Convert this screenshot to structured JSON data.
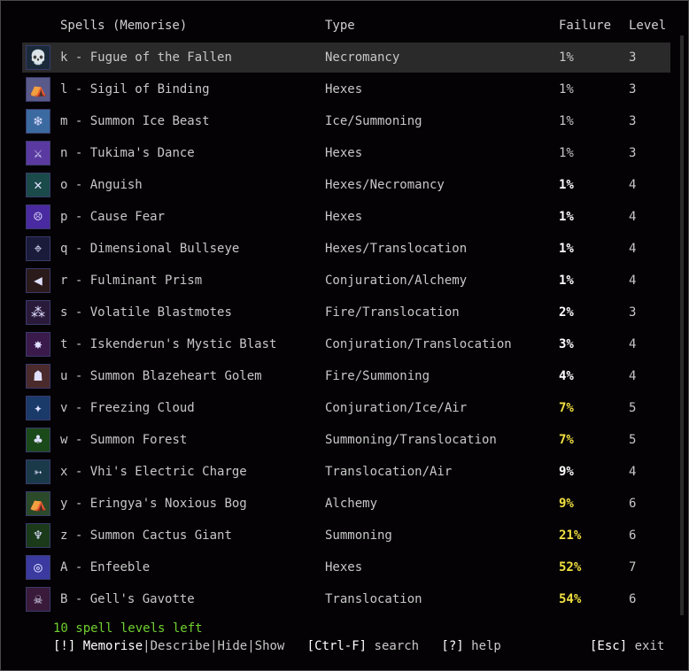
{
  "header": {
    "spells": "Spells (Memorise)",
    "type": "Type",
    "failure": "Failure",
    "level": "Level"
  },
  "spells": [
    {
      "key": "k",
      "name": "Fugue of the Fallen",
      "type": "Necromancy",
      "failure": "1%",
      "level": "3",
      "fail_style": "gray",
      "icon": "skull-icon",
      "glyph": "💀",
      "icon_bg": "#1a2a3a",
      "selected": true
    },
    {
      "key": "l",
      "name": "Sigil of Binding",
      "type": "Hexes",
      "failure": "1%",
      "level": "3",
      "fail_style": "gray",
      "icon": "sigil-icon",
      "glyph": "⛺",
      "icon_bg": "#5a5a8a",
      "selected": false
    },
    {
      "key": "m",
      "name": "Summon Ice Beast",
      "type": "Ice/Summoning",
      "failure": "1%",
      "level": "3",
      "fail_style": "gray",
      "icon": "ice-beast-icon",
      "glyph": "❄",
      "icon_bg": "#3a6aa0",
      "selected": false
    },
    {
      "key": "n",
      "name": "Tukima's Dance",
      "type": "Hexes",
      "failure": "1%",
      "level": "3",
      "fail_style": "gray",
      "icon": "dance-icon",
      "glyph": "⚔",
      "icon_bg": "#5a3aa0",
      "selected": false
    },
    {
      "key": "o",
      "name": "Anguish",
      "type": "Hexes/Necromancy",
      "failure": "1%",
      "level": "4",
      "fail_style": "white",
      "icon": "anguish-icon",
      "glyph": "✕",
      "icon_bg": "#1a4a4a",
      "selected": false
    },
    {
      "key": "p",
      "name": "Cause Fear",
      "type": "Hexes",
      "failure": "1%",
      "level": "4",
      "fail_style": "white",
      "icon": "fear-icon",
      "glyph": "☹",
      "icon_bg": "#4a2aa0",
      "selected": false
    },
    {
      "key": "q",
      "name": "Dimensional Bullseye",
      "type": "Hexes/Translocation",
      "failure": "1%",
      "level": "4",
      "fail_style": "white",
      "icon": "bullseye-icon",
      "glyph": "⌖",
      "icon_bg": "#1a1a3a",
      "selected": false
    },
    {
      "key": "r",
      "name": "Fulminant Prism",
      "type": "Conjuration/Alchemy",
      "failure": "1%",
      "level": "4",
      "fail_style": "white",
      "icon": "prism-icon",
      "glyph": "◀",
      "icon_bg": "#2a1a1a",
      "selected": false
    },
    {
      "key": "s",
      "name": "Volatile Blastmotes",
      "type": "Fire/Translocation",
      "failure": "2%",
      "level": "3",
      "fail_style": "white",
      "icon": "blastmotes-icon",
      "glyph": "⁂",
      "icon_bg": "#2a1a3a",
      "selected": false
    },
    {
      "key": "t",
      "name": "Iskenderun's Mystic Blast",
      "type": "Conjuration/Translocation",
      "failure": "3%",
      "level": "4",
      "fail_style": "white",
      "icon": "mystic-blast-icon",
      "glyph": "✸",
      "icon_bg": "#3a1a4a",
      "selected": false
    },
    {
      "key": "u",
      "name": "Summon Blazeheart Golem",
      "type": "Fire/Summoning",
      "failure": "4%",
      "level": "4",
      "fail_style": "white",
      "icon": "golem-icon",
      "glyph": "☗",
      "icon_bg": "#4a2a2a",
      "selected": false
    },
    {
      "key": "v",
      "name": "Freezing Cloud",
      "type": "Conjuration/Ice/Air",
      "failure": "7%",
      "level": "5",
      "fail_style": "yellow",
      "icon": "freezing-cloud-icon",
      "glyph": "✦",
      "icon_bg": "#1a3a6a",
      "selected": false
    },
    {
      "key": "w",
      "name": "Summon Forest",
      "type": "Summoning/Translocation",
      "failure": "7%",
      "level": "5",
      "fail_style": "yellow",
      "icon": "forest-icon",
      "glyph": "♣",
      "icon_bg": "#1a4a1a",
      "selected": false
    },
    {
      "key": "x",
      "name": "Vhi's Electric Charge",
      "type": "Translocation/Air",
      "failure": "9%",
      "level": "4",
      "fail_style": "white",
      "icon": "electric-charge-icon",
      "glyph": "➳",
      "icon_bg": "#1a3a4a",
      "selected": false
    },
    {
      "key": "y",
      "name": "Eringya's Noxious Bog",
      "type": "Alchemy",
      "failure": "9%",
      "level": "6",
      "fail_style": "yellow",
      "icon": "bog-icon",
      "glyph": "⛺",
      "icon_bg": "#2a4a2a",
      "selected": false
    },
    {
      "key": "z",
      "name": "Summon Cactus Giant",
      "type": "Summoning",
      "failure": "21%",
      "level": "6",
      "fail_style": "yellow",
      "icon": "cactus-icon",
      "glyph": "♆",
      "icon_bg": "#1a3a1a",
      "selected": false
    },
    {
      "key": "A",
      "name": "Enfeeble",
      "type": "Hexes",
      "failure": "52%",
      "level": "7",
      "fail_style": "yellow",
      "icon": "enfeeble-icon",
      "glyph": "◎",
      "icon_bg": "#3a3aa0",
      "selected": false
    },
    {
      "key": "B",
      "name": "Gell's Gavotte",
      "type": "Translocation",
      "failure": "54%",
      "level": "6",
      "fail_style": "yellow",
      "icon": "gavotte-icon",
      "glyph": "☠",
      "icon_bg": "#3a1a3a",
      "selected": false
    }
  ],
  "footer": {
    "levels_left": "10 spell levels left",
    "memorise_key": "[!]",
    "memorise": "Memorise",
    "describe": "Describe",
    "hide": "Hide",
    "show": "Show",
    "search_key": "[Ctrl-F]",
    "search": "search",
    "help_key": "[?]",
    "help": "help",
    "exit_key": "[Esc]",
    "exit": "exit"
  }
}
